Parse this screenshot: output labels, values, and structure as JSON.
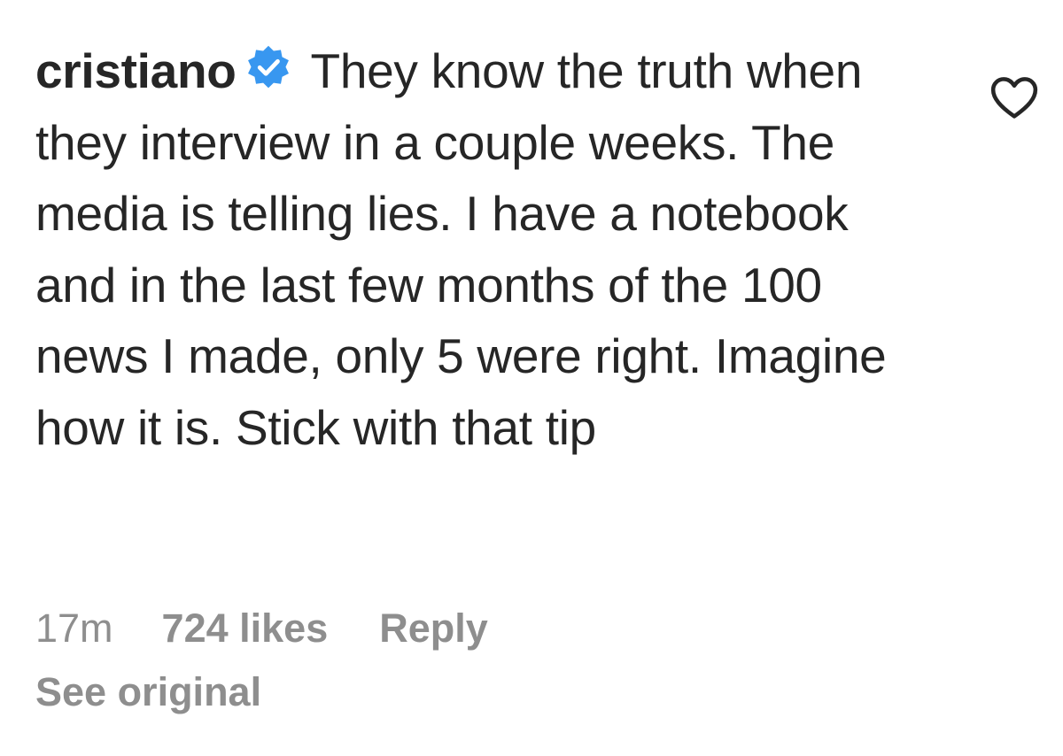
{
  "comment": {
    "username": "cristiano",
    "verified_icon": "verified-badge-icon",
    "text": "They know the truth when they interview in a couple weeks. The media is telling lies. I have a notebook and in the last few months of the 100 news I made, only 5 were right. Imagine how it is. Stick with that tip",
    "like_icon": "heart-outline-icon",
    "timestamp": "17m",
    "likes_label": "724 likes",
    "reply_label": "Reply",
    "see_original_label": "See original"
  },
  "colors": {
    "text_primary": "#262626",
    "text_secondary": "#8e8e8e",
    "verified_blue": "#3897f0",
    "background": "#ffffff"
  }
}
